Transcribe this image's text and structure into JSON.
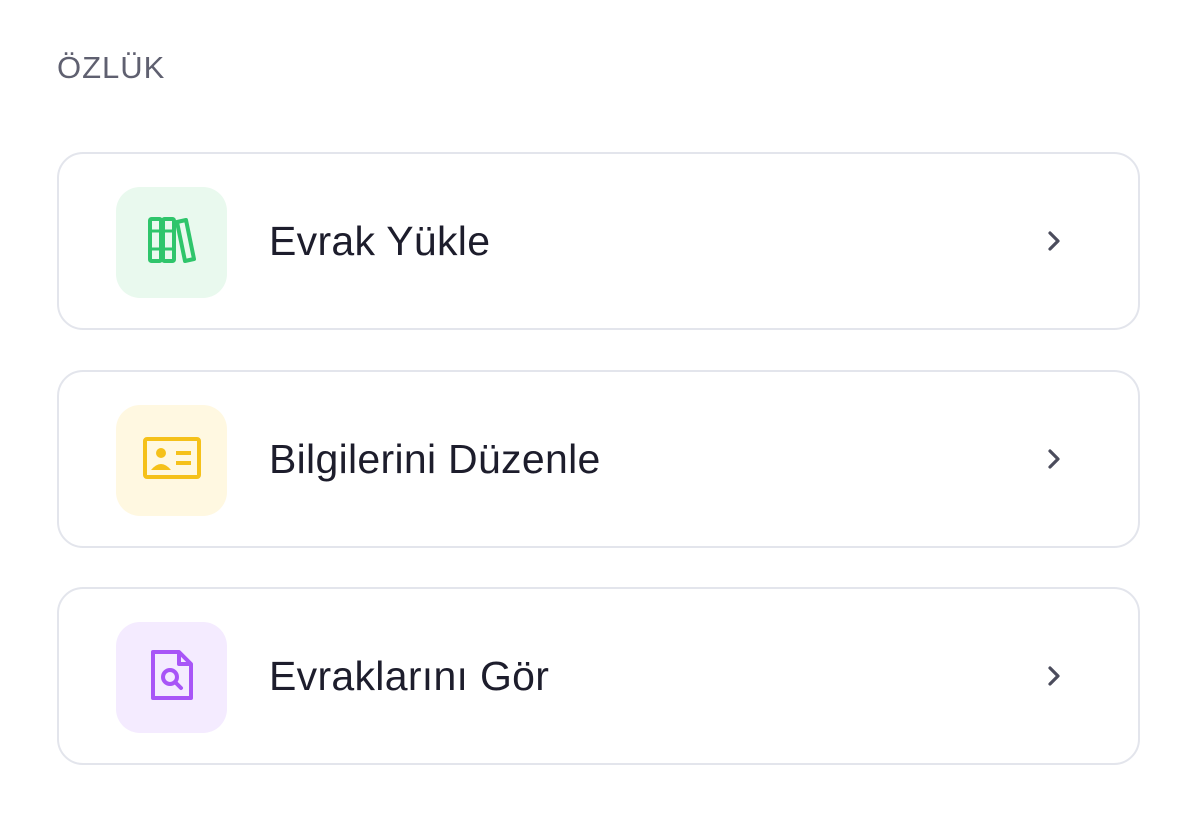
{
  "section": {
    "title": "ÖZLÜK"
  },
  "items": [
    {
      "label": "Evrak Yükle",
      "icon": "books-icon",
      "tile_color": "#e9f9ee",
      "icon_color": "#2fc56b"
    },
    {
      "label": "Bilgilerini Düzenle",
      "icon": "id-card-icon",
      "tile_color": "#fff8e1",
      "icon_color": "#f5c11a"
    },
    {
      "label": "Evraklarını Gör",
      "icon": "document-search-icon",
      "tile_color": "#f4ebff",
      "icon_color": "#a855f7"
    }
  ],
  "colors": {
    "text": "#1d1d2c",
    "muted": "#5f6070",
    "border": "#e3e5ec",
    "chevron": "#4b4c5c"
  }
}
